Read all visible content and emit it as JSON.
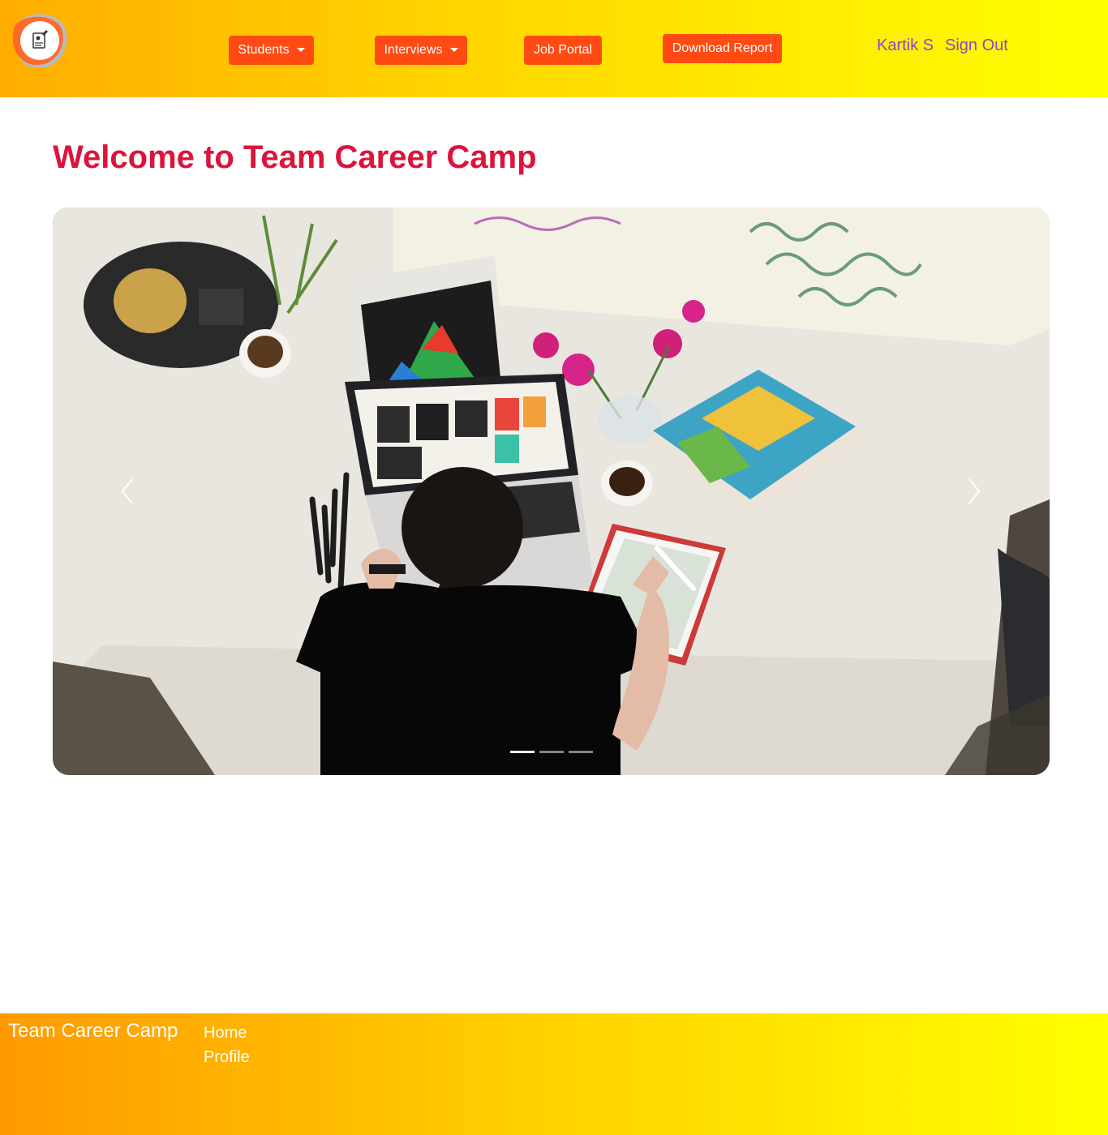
{
  "header": {
    "logo_icon": "resume-badge-icon",
    "nav": {
      "students_label": "Students",
      "interviews_label": "Interviews",
      "job_portal_label": "Job Portal",
      "download_report_label": "Download Report"
    },
    "user_name": "Kartik S",
    "sign_out_label": "Sign Out"
  },
  "main": {
    "title": "Welcome to Team Career Camp",
    "carousel": {
      "slide_count": 3,
      "active_slide": 1,
      "prev_icon": "chevron-left-icon",
      "next_icon": "chevron-right-icon"
    }
  },
  "footer": {
    "brand": "Team Career Camp",
    "links": [
      "Home",
      "Profile"
    ]
  },
  "colors": {
    "accent_button": "#ff4a13",
    "title": "#dc143c",
    "user_link": "#8e44c6",
    "gradient_start": "#ffad00",
    "gradient_end": "#ffff00"
  }
}
